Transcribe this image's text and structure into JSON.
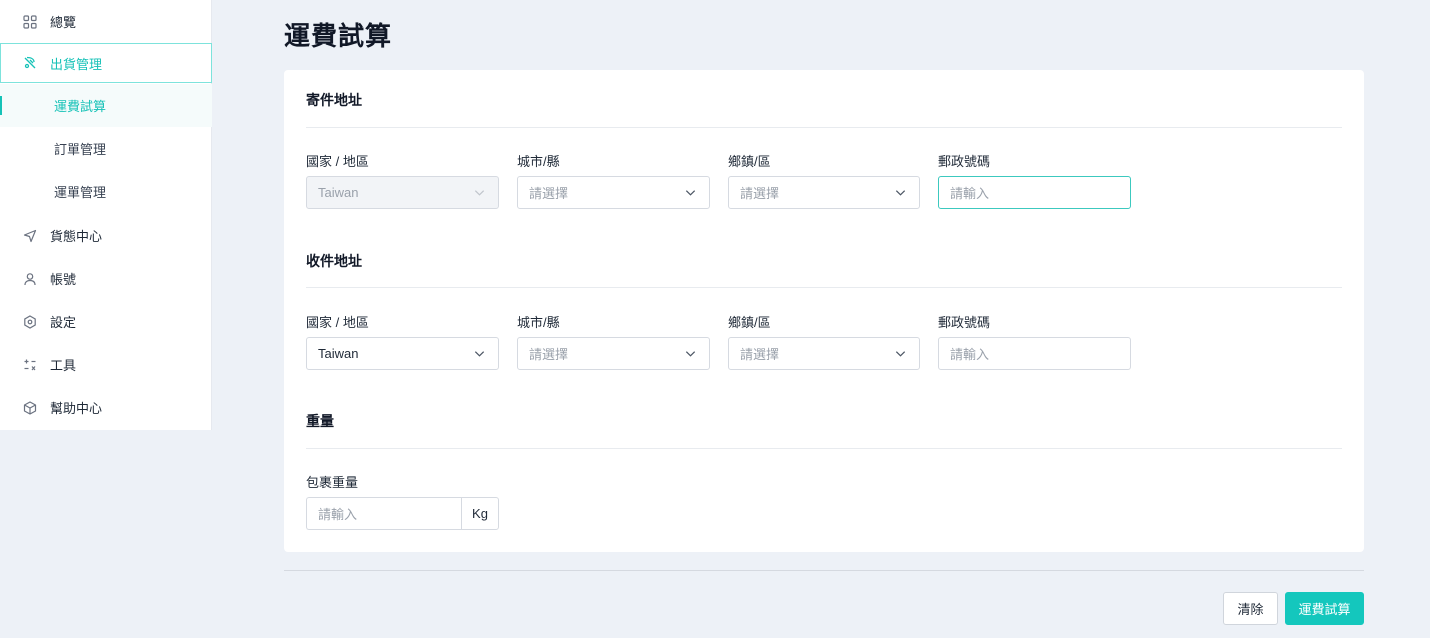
{
  "sidebar": {
    "items": [
      {
        "label": "總覽",
        "icon": "grid-icon"
      },
      {
        "label": "出貨管理",
        "icon": "shipping-icon"
      },
      {
        "label": "貨態中心",
        "icon": "navigation-arrow-icon"
      },
      {
        "label": "帳號",
        "icon": "user-icon"
      },
      {
        "label": "設定",
        "icon": "settings-hexagon-icon"
      },
      {
        "label": "工具",
        "icon": "tools-icon"
      },
      {
        "label": "幫助中心",
        "icon": "package-icon"
      }
    ],
    "sub_items": [
      {
        "label": "運費試算"
      },
      {
        "label": "訂單管理"
      },
      {
        "label": "運單管理"
      }
    ]
  },
  "page": {
    "title": "運費試算"
  },
  "sender": {
    "title": "寄件地址",
    "country_label": "國家 / 地區",
    "country_value": "Taiwan",
    "city_label": "城市/縣",
    "city_placeholder": "請選擇",
    "district_label": "鄉鎮/區",
    "district_placeholder": "請選擇",
    "zip_label": "郵政號碼",
    "zip_placeholder": "請輸入"
  },
  "receiver": {
    "title": "收件地址",
    "country_label": "國家 / 地區",
    "country_value": "Taiwan",
    "city_label": "城市/縣",
    "city_placeholder": "請選擇",
    "district_label": "鄉鎮/區",
    "district_placeholder": "請選擇",
    "zip_label": "郵政號碼",
    "zip_placeholder": "請輸入"
  },
  "weight": {
    "title": "重量",
    "label": "包裹重量",
    "placeholder": "請輸入",
    "unit": "Kg"
  },
  "actions": {
    "clear_label": "清除",
    "calculate_label": "運費試算"
  },
  "colors": {
    "accent": "#14c7bd",
    "background": "#edf1f7"
  }
}
